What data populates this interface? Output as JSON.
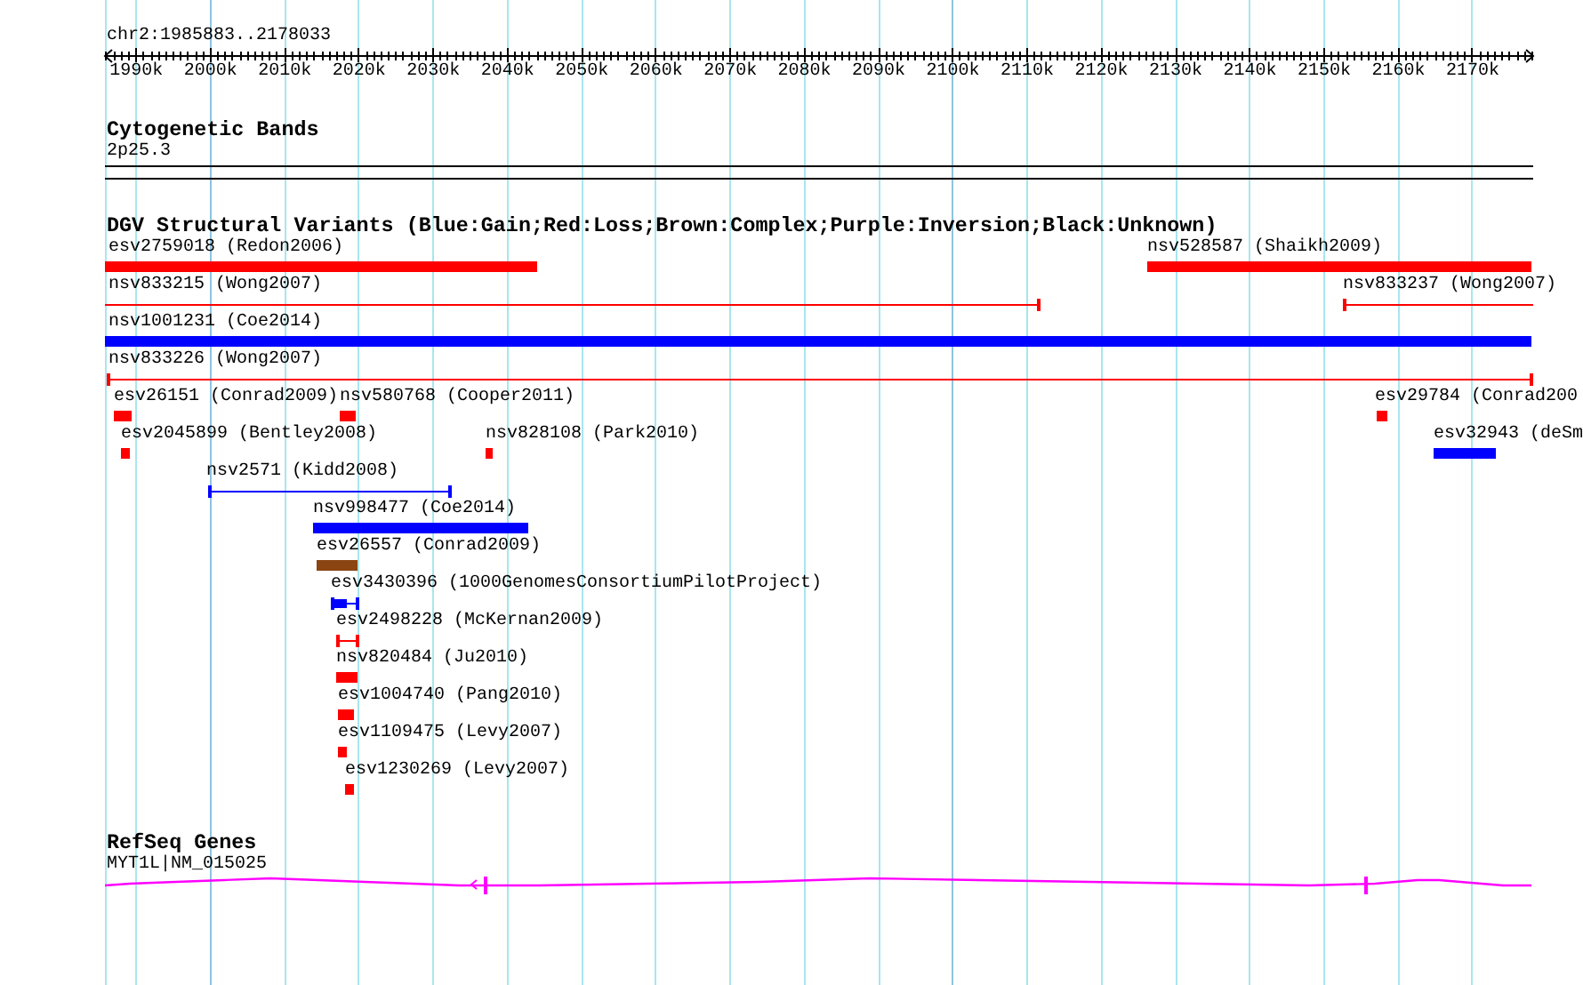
{
  "ruler": {
    "title": "chr2:1985883..2178033",
    "ticks": [
      "1990k",
      "2000k",
      "2010k",
      "2020k",
      "2030k",
      "2040k",
      "2050k",
      "2060k",
      "2070k",
      "2080k",
      "2090k",
      "2100k",
      "2110k",
      "2120k",
      "2130k",
      "2140k",
      "2150k",
      "2160k",
      "2170k"
    ]
  },
  "tracks": [
    {
      "kind": "cytoband",
      "title": "Cytogenetic Bands",
      "bands": [
        {
          "label": "2p25.3"
        }
      ]
    },
    {
      "kind": "variants",
      "title": "DGV Structural Variants (Blue:Gain;Red:Loss;Brown:Complex;Purple:Inversion;Black:Unknown)",
      "features": [
        {
          "label": "esv2759018 (Redon2006)",
          "kind": "bar",
          "color": "#ff0000"
        },
        {
          "label": "nsv528587 (Shaikh2009)",
          "kind": "bar",
          "color": "#ff0000"
        },
        {
          "label": "nsv833215 (Wong2007)",
          "kind": "line",
          "color": "#ff0000"
        },
        {
          "label": "nsv833237 (Wong2007)",
          "kind": "line",
          "color": "#ff0000"
        },
        {
          "label": "nsv1001231 (Coe2014)",
          "kind": "bar",
          "color": "#0000ff"
        },
        {
          "label": "nsv833226 (Wong2007)",
          "kind": "line",
          "color": "#ff0000"
        },
        {
          "label": "esv26151 (Conrad2009)",
          "kind": "bar",
          "color": "#ff0000"
        },
        {
          "label": "nsv580768 (Cooper2011)",
          "kind": "bar",
          "color": "#ff0000"
        },
        {
          "label": "esv29784 (Conrad200",
          "kind": "bar",
          "color": "#ff0000"
        },
        {
          "label": "esv2045899 (Bentley2008)",
          "kind": "bar",
          "color": "#ff0000"
        },
        {
          "label": "nsv828108 (Park2010)",
          "kind": "bar",
          "color": "#ff0000"
        },
        {
          "label": "esv32943 (deSm",
          "kind": "bar",
          "color": "#0000ff"
        },
        {
          "label": "nsv2571 (Kidd2008)",
          "kind": "line",
          "color": "#0000ff"
        },
        {
          "label": "nsv998477 (Coe2014)",
          "kind": "bar",
          "color": "#0000ff"
        },
        {
          "label": "esv26557 (Conrad2009)",
          "kind": "bar",
          "color": "#8b4513"
        },
        {
          "label": "esv3430396 (1000GenomesConsortiumPilotProject)",
          "kind": "mixed",
          "color": "#0000ff"
        },
        {
          "label": "esv2498228 (McKernan2009)",
          "kind": "line",
          "color": "#ff0000"
        },
        {
          "label": "nsv820484 (Ju2010)",
          "kind": "bar",
          "color": "#ff0000"
        },
        {
          "label": "esv1004740 (Pang2010)",
          "kind": "bar",
          "color": "#ff0000"
        },
        {
          "label": "esv1109475 (Levy2007)",
          "kind": "bar",
          "color": "#ff0000"
        },
        {
          "label": "esv1230269 (Levy2007)",
          "kind": "bar",
          "color": "#ff0000"
        }
      ]
    },
    {
      "kind": "genes",
      "title": "RefSeq Genes",
      "genes": [
        {
          "label": "MYT1L|NM_015025"
        }
      ]
    }
  ]
}
